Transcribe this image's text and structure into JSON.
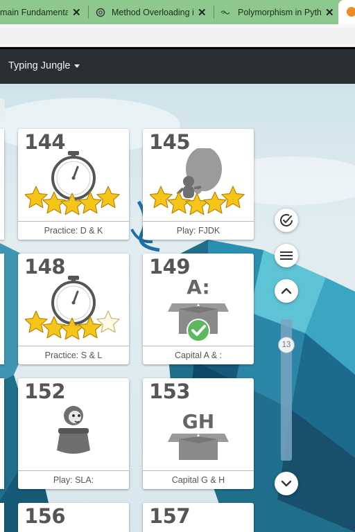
{
  "browser": {
    "tabs": [
      {
        "title": "main Fundamentals",
        "close": "✕"
      },
      {
        "title": "Method Overloading i",
        "close": "✕"
      },
      {
        "title": "Polymorphism in Pyth",
        "close": "✕"
      }
    ]
  },
  "nav": {
    "brand": "Typing Jungle"
  },
  "lessons": [
    {
      "number": "144",
      "label": "Practice: D & K",
      "kind": "timer",
      "stars": 5
    },
    {
      "number": "145",
      "label": "Play: FJDK",
      "kind": "game",
      "stars": 5
    },
    {
      "number": "148",
      "label": "Practice: S & L",
      "kind": "timer",
      "stars": 4
    },
    {
      "number": "149",
      "label": "Capital A & :",
      "kind": "box",
      "box_text": "A:",
      "completed": true
    },
    {
      "number": "152",
      "label": "Play: SLA:",
      "kind": "game-pot"
    },
    {
      "number": "153",
      "label": "Capital G & H",
      "kind": "box",
      "box_text": "GH",
      "completed": false
    },
    {
      "number": "156",
      "label": "",
      "kind": "partial"
    },
    {
      "number": "157",
      "label": "",
      "kind": "partial"
    }
  ],
  "controls": {
    "icons": [
      "check-circle-icon",
      "menu-icon",
      "chevron-up-icon",
      "chevron-down-icon"
    ],
    "page_indicator": "13"
  },
  "colors": {
    "nav_bg": "#2a2f34",
    "tab_bg": "#8dc98f",
    "star": "#f5c518",
    "check": "#5cb85c"
  }
}
